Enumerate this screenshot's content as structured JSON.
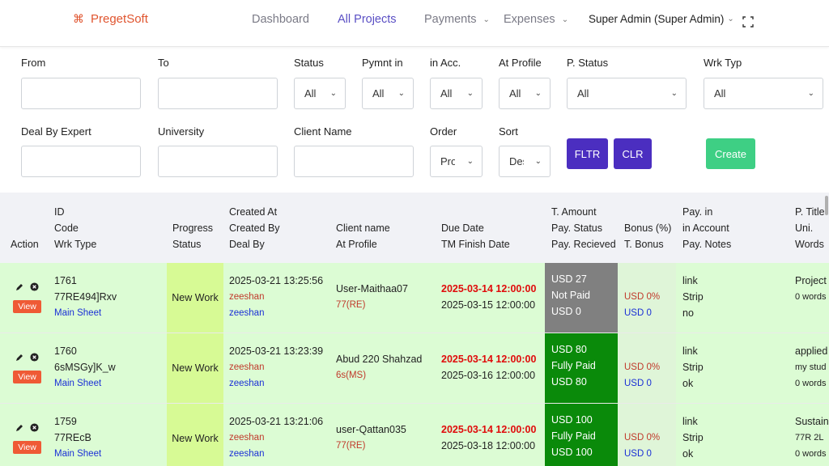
{
  "header": {
    "brand": "PregetSoft",
    "brand_icon": "command-icon",
    "nav": {
      "dashboard": "Dashboard",
      "all_projects": "All Projects",
      "payments": "Payments",
      "expenses": "Expenses"
    },
    "user": "Super Admin (Super Admin)",
    "fullscreen_icon": "fullscreen-icon"
  },
  "filters": {
    "from": "From",
    "to": "To",
    "status": "Status",
    "status_val": "All",
    "pymnt_in": "Pymnt in",
    "pymnt_in_val": "All",
    "in_acc": "in Acc.",
    "in_acc_val": "All",
    "at_profile": "At Profile",
    "at_profile_val": "All",
    "p_status": "P. Status",
    "p_status_val": "All",
    "wrk_typ": "Wrk Typ",
    "wrk_typ_val": "All",
    "deal_by_expert": "Deal By Expert",
    "university": "University",
    "client_name": "Client Name",
    "order": "Order",
    "order_val": "Pro",
    "sort": "Sort",
    "sort_val": "Des",
    "filter_btn": "FLTR",
    "clear_btn": "CLR",
    "create_btn": "Create"
  },
  "table": {
    "headers": {
      "action": "Action",
      "id": "ID",
      "code": "Code",
      "wrk_type": "Wrk Type",
      "progress": "Progress",
      "status": "Status",
      "created_at": "Created At",
      "created_by": "Created By",
      "deal_by": "Deal By",
      "client_name": "Client name",
      "at_profile": "At Profile",
      "due_date": "Due Date",
      "tm_finish": "TM Finish Date",
      "t_amount": "T. Amount",
      "pay_status": "Pay. Status",
      "pay_received": "Pay. Recieved",
      "bonus_pct": "Bonus (%)",
      "t_bonus": "T. Bonus",
      "pay_in": "Pay. in",
      "in_account": "in Account",
      "pay_notes": "Pay. Notes",
      "p_title": "P. Title",
      "uni": "Uni.",
      "words": "Words"
    },
    "view_label": "View",
    "rows": [
      {
        "id": "1761",
        "code": "77RE494]Rxv",
        "wrk_type": "Main Sheet",
        "progress": "New Work",
        "created_at": "2025-03-21 13:25:56",
        "created_by": "zeeshan",
        "deal_by": "zeeshan",
        "client": "User-Maithaa07",
        "profile": "77(RE)",
        "due": "2025-03-14 12:00:00",
        "finish": "2025-03-15 12:00:00",
        "amount": "USD 27",
        "pay_status": "Not Paid",
        "received": "USD 0",
        "amount_bg": "#808080",
        "bonus_pct": "USD 0%",
        "bonus": "USD 0",
        "pay_in": "link",
        "in_account": "Strip",
        "notes": "no",
        "title": "Project",
        "uni": "",
        "words": "0 words"
      },
      {
        "id": "1760",
        "code": "6sMSGy]K_w",
        "wrk_type": "Main Sheet",
        "progress": "New Work",
        "created_at": "2025-03-21 13:23:39",
        "created_by": "zeeshan",
        "deal_by": "zeeshan",
        "client": "Abud 220 Shahzad",
        "profile": "6s(MS)",
        "due": "2025-03-14 12:00:00",
        "finish": "2025-03-16 12:00:00",
        "amount": "USD 80",
        "pay_status": "Fully Paid",
        "received": "USD 80",
        "amount_bg": "#0a8a0a",
        "bonus_pct": "USD 0%",
        "bonus": "USD 0",
        "pay_in": "link",
        "in_account": "Strip",
        "notes": "ok",
        "title": "applied",
        "uni": "my stud",
        "words": "0 words"
      },
      {
        "id": "1759",
        "code": "77REcB",
        "wrk_type": "Main Sheet",
        "progress": "New Work",
        "created_at": "2025-03-21 13:21:06",
        "created_by": "zeeshan",
        "deal_by": "zeeshan",
        "client": "user-Qattan035",
        "profile": "77(RE)",
        "due": "2025-03-14 12:00:00",
        "finish": "2025-03-18 12:00:00",
        "amount": "USD 100",
        "pay_status": "Fully Paid",
        "received": "USD 100",
        "amount_bg": "#0a8a0a",
        "bonus_pct": "USD 0%",
        "bonus": "USD 0",
        "pay_in": "link",
        "in_account": "Strip",
        "notes": "ok",
        "title": "Sustain",
        "uni": "77R 2L",
        "words": "0 words"
      }
    ]
  }
}
